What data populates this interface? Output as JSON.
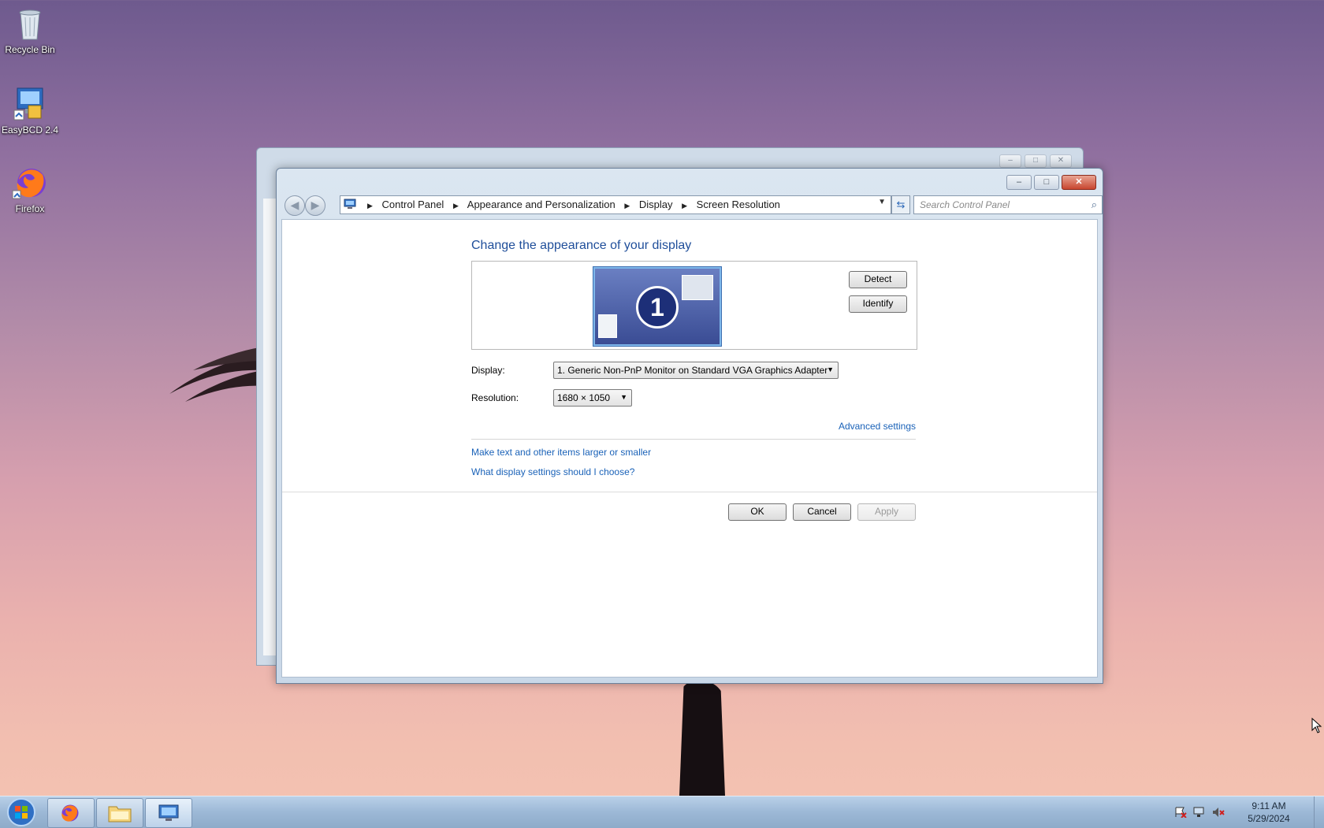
{
  "desktop": {
    "icons": [
      {
        "label": "Recycle Bin",
        "icon": "recycle-bin-icon"
      },
      {
        "label": "EasyBCD 2.4",
        "icon": "easybcd-icon"
      },
      {
        "label": "Firefox",
        "icon": "firefox-icon"
      }
    ]
  },
  "window": {
    "controls": {
      "minimize": "–",
      "maximize": "□",
      "close": "✕"
    },
    "nav": {
      "back": "◀",
      "forward": "▶"
    },
    "breadcrumb": [
      "Control Panel",
      "Appearance and Personalization",
      "Display",
      "Screen Resolution"
    ],
    "search": {
      "placeholder": "Search Control Panel"
    },
    "title": "Change the appearance of your display",
    "monitor_number": "1",
    "detect_label": "Detect",
    "identify_label": "Identify",
    "display": {
      "label": "Display:",
      "value": "1. Generic Non-PnP Monitor on Standard VGA Graphics Adapter"
    },
    "resolution": {
      "label": "Resolution:",
      "value": "1680 × 1050"
    },
    "advanced_link": "Advanced settings",
    "links": [
      "Make text and other items larger or smaller",
      "What display settings should I choose?"
    ],
    "ok_label": "OK",
    "cancel_label": "Cancel",
    "apply_label": "Apply"
  },
  "taskbar": {
    "time": "9:11 AM",
    "date": "5/29/2024"
  },
  "colors": {
    "accent": "#1f4e9a",
    "link": "#1a62b8"
  }
}
